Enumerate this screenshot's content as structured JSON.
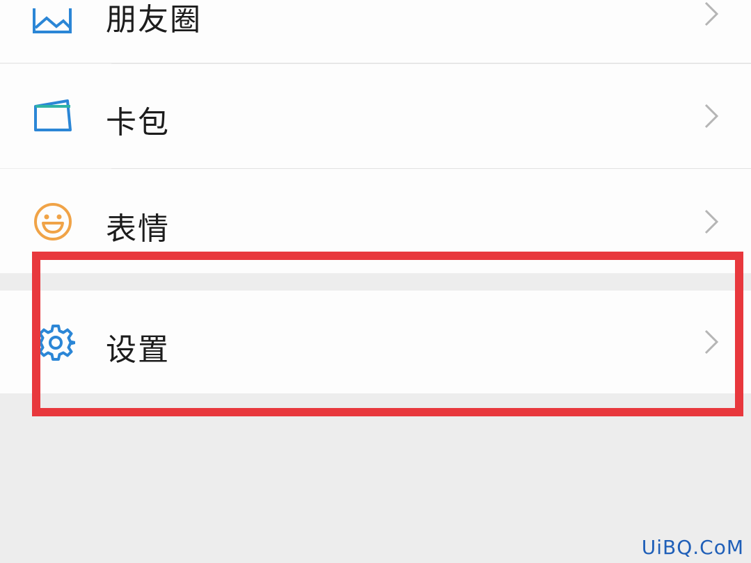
{
  "menu": {
    "moments": {
      "label": "朋友圈",
      "icon": "moments-image-icon"
    },
    "cards": {
      "label": "卡包",
      "icon": "card-wallet-icon"
    },
    "stickers": {
      "label": "表情",
      "icon": "smiley-face-icon"
    },
    "settings": {
      "label": "设置",
      "icon": "gear-icon"
    }
  },
  "highlight_color": "#e8383d",
  "icon_colors": {
    "blue": "#2b86d6",
    "orange": "#f0a347",
    "chevron": "#b5b5b5"
  },
  "watermark": "UiBQ.CoM"
}
